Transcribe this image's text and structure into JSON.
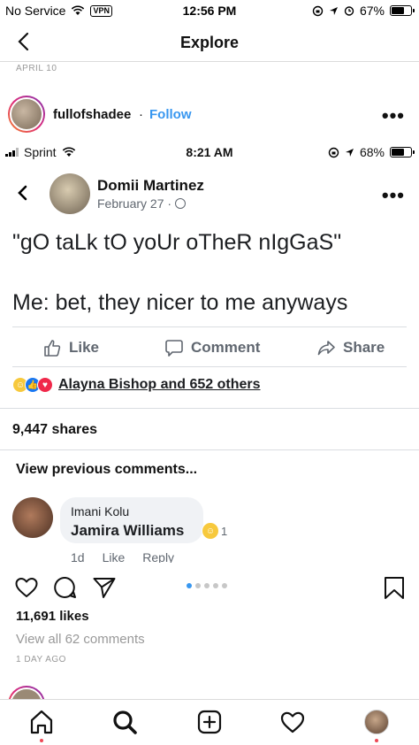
{
  "status_bar": {
    "carrier": "No Service",
    "vpn": "VPN",
    "time": "12:56 PM",
    "battery": "67%",
    "battery_level": 0.67
  },
  "header": {
    "title": "Explore"
  },
  "post": {
    "date": "APRIL 10",
    "username": "fullofshadee",
    "separator": "·",
    "follow_label": "Follow",
    "more": "•••",
    "likes": "11,691 likes",
    "view_comments": "View all 62 comments",
    "time_ago": "1 DAY AGO"
  },
  "embedded": {
    "status_bar": {
      "carrier": "Sprint",
      "time": "8:21 AM",
      "battery": "68%",
      "battery_level": 0.68
    },
    "author": "Domii Martinez",
    "date": "February 27 ·",
    "text_line1": "\"gO taLk tO yoUr oTheR nIgGaS\"",
    "text_line2": "Me: bet, they nicer to me anyways",
    "actions": {
      "like": "Like",
      "comment": "Comment",
      "share": "Share"
    },
    "reactions_text": "Alayna Bishop and 652 others",
    "shares": "9,447 shares",
    "view_previous": "View previous comments...",
    "comment": {
      "author": "Imani Kolu",
      "text": "Jamira Williams",
      "reaction_count": "1",
      "meta_time": "1d",
      "meta_like": "Like",
      "meta_reply": "Reply"
    }
  },
  "tab_bar": {
    "items": [
      "home-icon",
      "search-icon",
      "add-icon",
      "heart-icon",
      "profile-avatar"
    ]
  },
  "colors": {
    "instagram_blue": "#3897f0",
    "facebook_gray": "#606770",
    "notification_red": "#ed4956"
  }
}
